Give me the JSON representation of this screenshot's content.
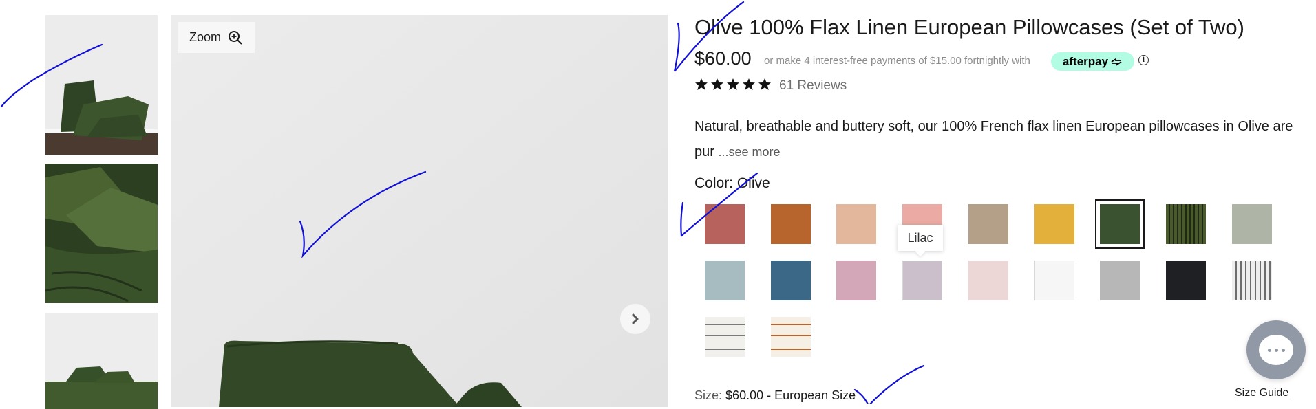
{
  "gallery": {
    "zoom_label": "Zoom"
  },
  "product": {
    "title": "Olive 100% Flax Linen European Pillowcases (Set of Two)",
    "price": "$60.00",
    "afterpay_text": "or make 4 interest-free payments of $15.00 fortnightly with",
    "afterpay_logo": "afterpay",
    "info_icon": "i",
    "rating": 5,
    "reviews": "61 Reviews",
    "description": "Natural, breathable and buttery soft, our 100% French flax linen European pillowcases in Olive are pur",
    "see_more": "...see more",
    "color_label": "Color: Olive",
    "swatches": [
      {
        "name": "swatch-rust",
        "color": "#b8625e"
      },
      {
        "name": "swatch-orange",
        "color": "#b8652d"
      },
      {
        "name": "swatch-peach",
        "color": "#e3b79b"
      },
      {
        "name": "swatch-pink",
        "color": "#ebaaa3"
      },
      {
        "name": "swatch-taupe",
        "color": "#b49f89"
      },
      {
        "name": "swatch-mustard",
        "color": "#e3b13b"
      },
      {
        "name": "swatch-olive",
        "color": "#3a5230",
        "selected": true
      },
      {
        "name": "swatch-olive-stripe",
        "color": "#4a5a2c",
        "pattern": "vstripe-dark"
      },
      {
        "name": "swatch-sage",
        "color": "#aeb4a6"
      },
      {
        "name": "swatch-seafoam",
        "color": "#a7bcc1"
      },
      {
        "name": "swatch-blue",
        "color": "#3b6886"
      },
      {
        "name": "swatch-mauve",
        "color": "#d3a7b7"
      },
      {
        "name": "swatch-lilac",
        "color": "#cbbfcc",
        "hovered": true
      },
      {
        "name": "swatch-blush",
        "color": "#ecd6d6"
      },
      {
        "name": "swatch-white",
        "color": "#f6f6f6"
      },
      {
        "name": "swatch-grey",
        "color": "#b7b7b7"
      },
      {
        "name": "swatch-black",
        "color": "#1f2024"
      },
      {
        "name": "swatch-pinstripe",
        "color": "#eeeeee",
        "pattern": "vstripe-grey"
      },
      {
        "name": "swatch-grey-stripe",
        "color": "#f2f0ec",
        "pattern": "hstripe-grey"
      },
      {
        "name": "swatch-rust-stripe",
        "color": "#f6efe6",
        "pattern": "hstripe-rust"
      }
    ],
    "tooltip": "Lilac",
    "size_label": "Size:",
    "size_value": "$60.00 - European Size",
    "size_guide": "Size Guide"
  },
  "colors": {
    "olive": "#3a5230",
    "afterpay_mint": "#b2fce4",
    "annotation_pen": "#1010d8"
  }
}
